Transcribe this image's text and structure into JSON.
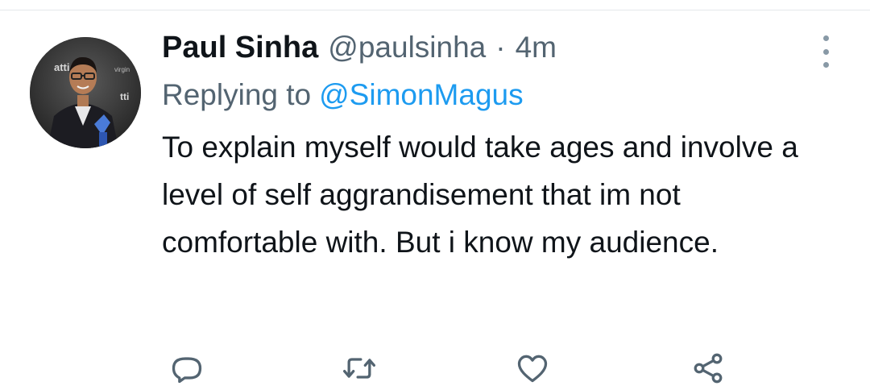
{
  "tweet": {
    "display_name": "Paul Sinha",
    "handle": "@paulsinha",
    "separator": "·",
    "time": "4m",
    "replying_prefix": "Replying to",
    "replying_to": "@SimonMagus",
    "text": "To explain myself would take ages and involve a level of self aggrandisement that im not comfortable with. But i know my audience."
  },
  "actions": {
    "reply_icon": "reply-icon",
    "retweet_icon": "retweet-icon",
    "like_icon": "heart-icon",
    "share_icon": "share-icon",
    "more_icon": "more-vertical-icon"
  },
  "colors": {
    "text": "#0f1419",
    "secondary": "#536471",
    "accent": "#1d9bf0",
    "icon": "#536471"
  },
  "avatar_logo_text": [
    "atti",
    "tti",
    "virgin"
  ]
}
